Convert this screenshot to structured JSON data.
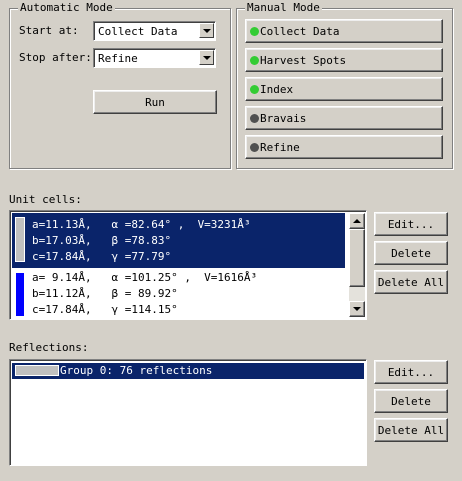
{
  "automatic_mode": {
    "title": "Automatic Mode",
    "start_label": "Start at:",
    "start_value": "Collect Data",
    "stop_label": "Stop after:",
    "stop_value": "Refine",
    "run_button": "Run"
  },
  "manual_mode": {
    "title": "Manual Mode",
    "buttons": [
      {
        "label": "Collect Data",
        "status": "done",
        "dot_color": "#33cc33"
      },
      {
        "label": "Harvest Spots",
        "status": "done",
        "dot_color": "#33cc33"
      },
      {
        "label": "Index",
        "status": "done",
        "dot_color": "#33cc33"
      },
      {
        "label": "Bravais",
        "status": "pending",
        "dot_color": "#505050"
      },
      {
        "label": "Refine",
        "status": "pending",
        "dot_color": "#505050"
      }
    ]
  },
  "unit_cells": {
    "title": "Unit cells:",
    "items": [
      {
        "selected": true,
        "swatch_color": "#c0c0c0",
        "lines": [
          "a=11.13Å,   α =82.64° ,  V=3231Å³",
          "b=17.03Å,   β =78.83°",
          "c=17.84Å,   γ =77.79°"
        ]
      },
      {
        "selected": false,
        "swatch_color": "#0000ff",
        "lines": [
          "a= 9.14Å,   α =101.25° ,  V=1616Å³",
          "b=11.12Å,   β = 89.92°",
          "c=17.84Å,   γ =114.15°"
        ]
      }
    ],
    "buttons": {
      "edit": "Edit...",
      "delete": "Delete",
      "delete_all": "Delete All"
    }
  },
  "reflections": {
    "title": "Reflections:",
    "items": [
      {
        "label": "Group 0: 76 reflections",
        "selected": true,
        "swatch_color": "#c0c0c0"
      }
    ],
    "buttons": {
      "edit": "Edit...",
      "delete": "Delete",
      "delete_all": "Delete All"
    }
  },
  "colors": {
    "selection": "#0a246a",
    "window": "#d4d0c8"
  }
}
